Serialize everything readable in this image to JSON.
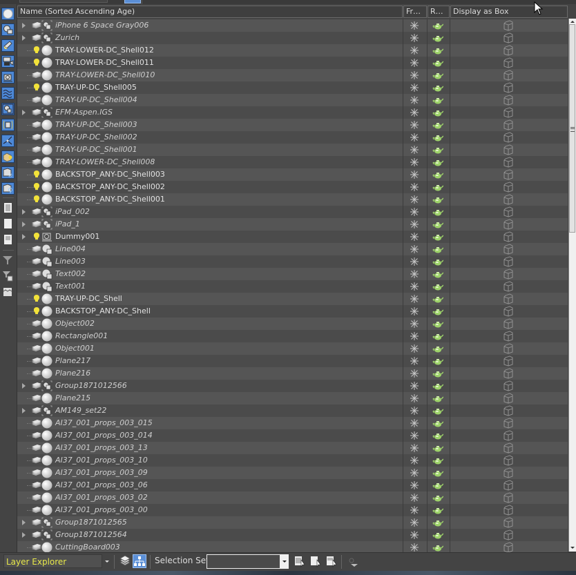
{
  "columns": {
    "name": "Name (Sorted Ascending Age)",
    "frozen": "Fr…",
    "render": "R…",
    "display_as_box": "Display as Box"
  },
  "left_toolbar": [
    {
      "icon": "geometry-filter-icon",
      "active": true
    },
    {
      "icon": "shapes-filter-icon",
      "active": true
    },
    {
      "icon": "lights-filter-icon",
      "active": true
    },
    {
      "icon": "cameras-filter-icon",
      "active": true
    },
    {
      "icon": "helpers-filter-icon",
      "active": true
    },
    {
      "icon": "space-warps-filter-icon",
      "active": true
    },
    {
      "icon": "groups-filter-icon",
      "active": true
    },
    {
      "icon": "object-xrefs-filter-icon",
      "active": true
    },
    {
      "icon": "bones-filter-icon",
      "active": true
    },
    {
      "icon": "containers-filter-icon",
      "active": true
    },
    {
      "icon": "frozen-objects-filter-icon",
      "active": true
    },
    {
      "icon": "hidden-objects-filter-icon",
      "active": true
    },
    {
      "icon": "select-all-icon",
      "active": false
    },
    {
      "icon": "select-none-icon",
      "active": false
    },
    {
      "icon": "select-invert-icon",
      "active": false
    },
    {
      "icon": "filter-icon",
      "active": false
    },
    {
      "icon": "filter-options-icon",
      "active": false
    },
    {
      "icon": "collapse-icon",
      "active": false
    }
  ],
  "rows": [
    {
      "name": "iPhone 6 Space Gray006",
      "expandable": true,
      "state": "layer",
      "type": "group",
      "italic": true
    },
    {
      "name": "Zurich",
      "expandable": true,
      "state": "layer",
      "type": "group",
      "italic": true
    },
    {
      "name": "TRAY-LOWER-DC_Shell012",
      "expandable": false,
      "state": "light",
      "type": "geometry",
      "italic": false
    },
    {
      "name": "TRAY-LOWER-DC_Shell011",
      "expandable": false,
      "state": "light",
      "type": "geometry",
      "italic": false
    },
    {
      "name": "TRAY-LOWER-DC_Shell010",
      "expandable": false,
      "state": "layer",
      "type": "geometry",
      "italic": true
    },
    {
      "name": "TRAY-UP-DC_Shell005",
      "expandable": false,
      "state": "light",
      "type": "geometry",
      "italic": false
    },
    {
      "name": "TRAY-UP-DC_Shell004",
      "expandable": false,
      "state": "layer",
      "type": "geometry",
      "italic": true
    },
    {
      "name": "EFM-Aspen.IGS",
      "expandable": true,
      "state": "layer",
      "type": "group",
      "italic": true
    },
    {
      "name": "TRAY-UP-DC_Shell003",
      "expandable": false,
      "state": "layer",
      "type": "geometry",
      "italic": true
    },
    {
      "name": "TRAY-UP-DC_Shell002",
      "expandable": false,
      "state": "layer",
      "type": "geometry",
      "italic": true
    },
    {
      "name": "TRAY-UP-DC_Shell001",
      "expandable": false,
      "state": "layer",
      "type": "geometry",
      "italic": true
    },
    {
      "name": "TRAY-LOWER-DC_Shell008",
      "expandable": false,
      "state": "layer",
      "type": "geometry",
      "italic": true
    },
    {
      "name": "BACKSTOP_ANY-DC_Shell003",
      "expandable": false,
      "state": "light",
      "type": "geometry",
      "italic": false
    },
    {
      "name": "BACKSTOP_ANY-DC_Shell002",
      "expandable": false,
      "state": "light",
      "type": "geometry",
      "italic": false
    },
    {
      "name": "BACKSTOP_ANY-DC_Shell001",
      "expandable": false,
      "state": "light",
      "type": "geometry",
      "italic": false
    },
    {
      "name": "iPad_002",
      "expandable": true,
      "state": "layer",
      "type": "group",
      "italic": true
    },
    {
      "name": "iPad_1",
      "expandable": true,
      "state": "layer",
      "type": "group",
      "italic": true
    },
    {
      "name": "Dummy001",
      "expandable": true,
      "state": "light",
      "type": "helper",
      "italic": false
    },
    {
      "name": "Line004",
      "expandable": false,
      "state": "layer",
      "type": "shape",
      "italic": true
    },
    {
      "name": "Line003",
      "expandable": false,
      "state": "layer",
      "type": "shape",
      "italic": true
    },
    {
      "name": "Text002",
      "expandable": false,
      "state": "layer",
      "type": "shape",
      "italic": true
    },
    {
      "name": "Text001",
      "expandable": false,
      "state": "layer",
      "type": "shape",
      "italic": true
    },
    {
      "name": "TRAY-UP-DC_Shell",
      "expandable": false,
      "state": "light",
      "type": "geometry",
      "italic": false
    },
    {
      "name": "BACKSTOP_ANY-DC_Shell",
      "expandable": false,
      "state": "light",
      "type": "geometry",
      "italic": false
    },
    {
      "name": "Object002",
      "expandable": false,
      "state": "layer",
      "type": "geometry",
      "italic": true
    },
    {
      "name": "Rectangle001",
      "expandable": false,
      "state": "layer",
      "type": "geometry",
      "italic": true
    },
    {
      "name": "Object001",
      "expandable": false,
      "state": "layer",
      "type": "geometry",
      "italic": true
    },
    {
      "name": "Plane217",
      "expandable": false,
      "state": "layer",
      "type": "geometry",
      "italic": true
    },
    {
      "name": "Plane216",
      "expandable": false,
      "state": "layer",
      "type": "geometry",
      "italic": true
    },
    {
      "name": "Group1871012566",
      "expandable": true,
      "state": "layer",
      "type": "group",
      "italic": true
    },
    {
      "name": "Plane215",
      "expandable": false,
      "state": "layer",
      "type": "geometry",
      "italic": true
    },
    {
      "name": "AM149_set22",
      "expandable": true,
      "state": "layer",
      "type": "group",
      "italic": true
    },
    {
      "name": "AI37_001_props_003_015",
      "expandable": false,
      "state": "layer",
      "type": "geometry",
      "italic": true
    },
    {
      "name": "AI37_001_props_003_014",
      "expandable": false,
      "state": "layer",
      "type": "geometry",
      "italic": true
    },
    {
      "name": "AI37_001_props_003_13",
      "expandable": false,
      "state": "layer",
      "type": "geometry",
      "italic": true
    },
    {
      "name": "AI37_001_props_003_10",
      "expandable": false,
      "state": "layer",
      "type": "geometry",
      "italic": true
    },
    {
      "name": "AI37_001_props_003_09",
      "expandable": false,
      "state": "layer",
      "type": "geometry",
      "italic": true
    },
    {
      "name": "AI37_001_props_003_06",
      "expandable": false,
      "state": "layer",
      "type": "geometry",
      "italic": true
    },
    {
      "name": "AI37_001_props_003_02",
      "expandable": false,
      "state": "layer",
      "type": "geometry",
      "italic": true
    },
    {
      "name": "AI37_001_props_003_00",
      "expandable": false,
      "state": "layer",
      "type": "geometry",
      "italic": true
    },
    {
      "name": "Group1871012565",
      "expandable": true,
      "state": "layer",
      "type": "group",
      "italic": true
    },
    {
      "name": "Group1871012564",
      "expandable": true,
      "state": "layer",
      "type": "group",
      "italic": true
    },
    {
      "name": "CuttingBoard003",
      "expandable": false,
      "state": "layer",
      "type": "geometry",
      "italic": true
    }
  ],
  "bottom_bar": {
    "explorer_name": "Layer Explorer",
    "selection_set_label": "Selection Set:",
    "selection_set_value": ""
  },
  "colors": {
    "accent_blue": "#4d88d6",
    "explorer_text": "#e8e84a",
    "teapot_green": "#9ed36a",
    "bulb_yellow": "#f2e23a"
  }
}
